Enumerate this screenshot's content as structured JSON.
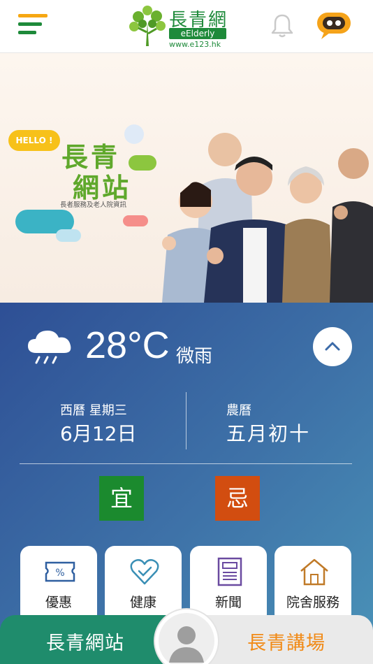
{
  "header": {
    "logo_cn": "長青網",
    "logo_badge": "eElderly",
    "logo_url": "www.e123.hk",
    "menu_icon": "hamburger-menu-icon",
    "bell_icon": "bell-icon",
    "chat_icon": "chatbot-icon",
    "colors": {
      "green": "#1e8a3a",
      "orange": "#f6a712"
    }
  },
  "hero": {
    "hello": "HELLO !",
    "title_line1": "長青",
    "title_line2": "網站",
    "subtitle": "長者服務及老人院資訊"
  },
  "weather": {
    "temperature": "28°C",
    "condition": "微雨",
    "icon": "rain-cloud-icon",
    "collapse_icon": "chevron-up-icon"
  },
  "dates": {
    "western_label": "西曆 星期三",
    "western_value": "6月12日",
    "lunar_label": "農曆",
    "lunar_value": "五月初十"
  },
  "almanac": {
    "yi": "宜",
    "ji": "忌",
    "yi_color": "#1b8a2e",
    "ji_color": "#d24d10"
  },
  "tiles": [
    {
      "label": "優惠",
      "icon": "coupon-icon"
    },
    {
      "label": "健康",
      "icon": "heart-check-icon"
    },
    {
      "label": "新聞",
      "icon": "newspaper-icon"
    },
    {
      "label": "院舍服務",
      "icon": "house-icon"
    }
  ],
  "bottom_nav": {
    "left_label": "長青網站",
    "right_label": "長青講場",
    "profile_icon": "user-profile-icon"
  }
}
